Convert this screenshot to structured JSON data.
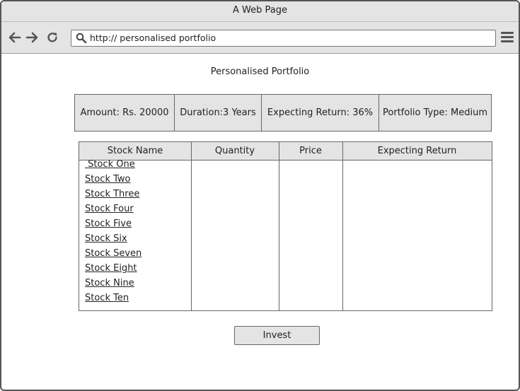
{
  "window": {
    "title": "A Web Page"
  },
  "toolbar": {
    "url": "http:// personalised portfolio",
    "icons": [
      "back-arrow-icon",
      "forward-arrow-icon",
      "refresh-icon",
      "search-icon",
      "hamburger-menu-icon"
    ]
  },
  "page": {
    "title": "Personalised Portfolio"
  },
  "summary": {
    "amount": "Amount: Rs. 20000",
    "duration": "Duration:3 Years",
    "expecting_return": "Expecting Return: 36%",
    "portfolio_type": "Portfolio Type: Medium"
  },
  "table": {
    "headers": {
      "stock_name": "Stock Name",
      "quantity": "Quantity",
      "price": "Price",
      "expecting_return": "Expecting Return"
    },
    "stocks": [
      " Stock One",
      "Stock Two",
      "Stock Three",
      "Stock Four",
      "Stock Five",
      "Stock Six",
      "Stock Seven",
      "Stock Eight",
      "Stock Nine",
      "Stock Ten"
    ]
  },
  "actions": {
    "invest_label": "Invest"
  },
  "colors": {
    "chrome": "#e4e4e4",
    "border": "#666666",
    "text": "#222222"
  }
}
